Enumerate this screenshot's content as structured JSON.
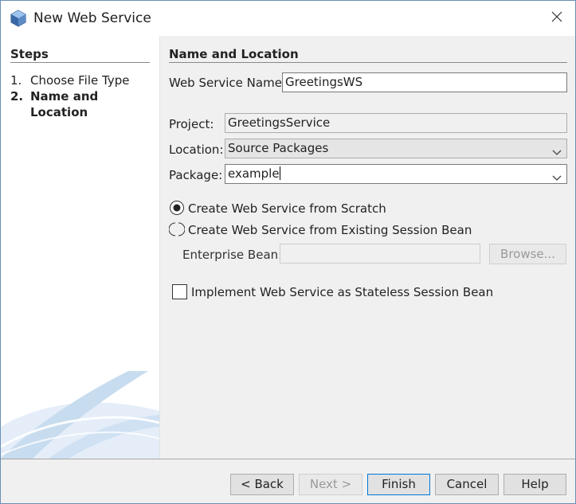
{
  "window": {
    "title": "New Web Service",
    "icon": "netbeans-cube-icon",
    "close_icon": "close-icon"
  },
  "steps": {
    "heading": "Steps",
    "items": [
      {
        "num": "1.",
        "label": "Choose File Type",
        "active": false
      },
      {
        "num": "2.",
        "label": "Name and Location",
        "active": true
      }
    ]
  },
  "form": {
    "heading": "Name and Location",
    "ws_name_label": "Web Service Name:",
    "ws_name_value": "GreetingsWS",
    "project_label": "Project:",
    "project_value": "GreetingsService",
    "location_label": "Location:",
    "location_value": "Source Packages",
    "package_label": "Package:",
    "package_value": "example",
    "radio_scratch_label": "Create Web Service from Scratch",
    "radio_scratch_selected": true,
    "radio_existing_label": "Create Web Service from Existing Session Bean",
    "radio_existing_selected": false,
    "enterprise_bean_label": "Enterprise Bean:",
    "enterprise_bean_value": "",
    "browse_label": "Browse...",
    "stateless_label": "Implement Web Service as Stateless Session Bean",
    "stateless_checked": false
  },
  "footer": {
    "back_label": "< Back",
    "next_label": "Next >",
    "finish_label": "Finish",
    "cancel_label": "Cancel",
    "help_label": "Help"
  },
  "colors": {
    "accent": "#0078d7",
    "panel_bg": "#f0f0f0",
    "swoosh": "#c8dcef"
  }
}
